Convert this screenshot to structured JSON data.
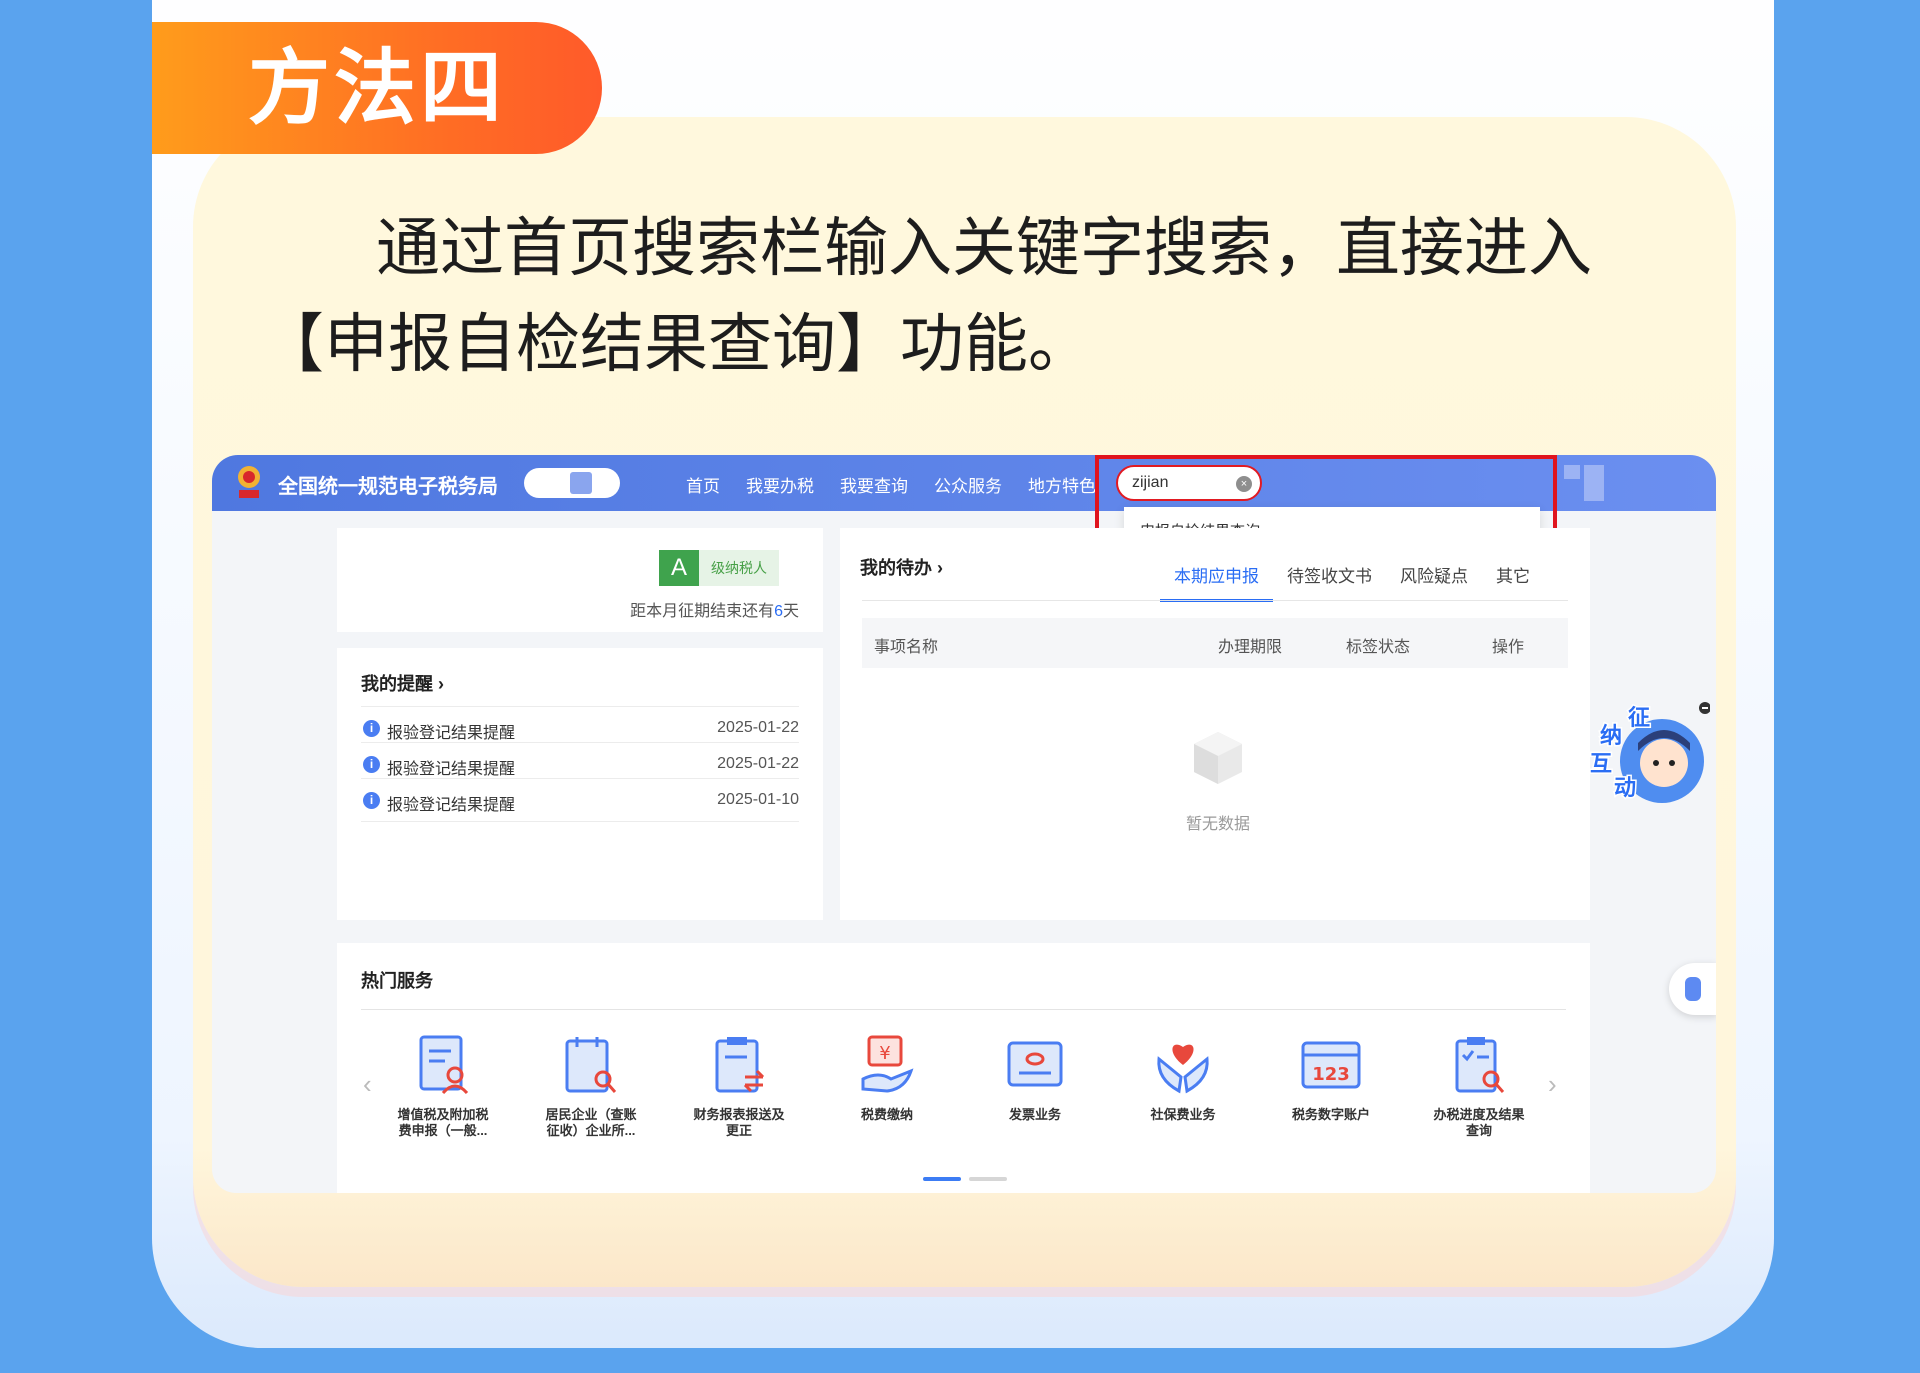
{
  "heading": "方法四",
  "intro": {
    "line1": "通过首页搜索栏输入关键字搜索，直接进入",
    "line2": "【申报自检结果查询】功能。"
  },
  "app": {
    "title": "全国统一规范电子税务局",
    "nav": [
      "首页",
      "我要办税",
      "我要查询",
      "公众服务",
      "地方特色"
    ],
    "search": {
      "value": "zijian",
      "suggestion": "申报自检结果查询"
    },
    "taxpayer": {
      "grade": "A",
      "grade_label": "级纳税人",
      "deadline_prefix": "距本月征期结束还有",
      "deadline_days": "6",
      "deadline_suffix": "天"
    },
    "reminders": {
      "title": "我的提醒",
      "items": [
        {
          "text": "报验登记结果提醒",
          "date": "2025-01-22"
        },
        {
          "text": "报验登记结果提醒",
          "date": "2025-01-22"
        },
        {
          "text": "报验登记结果提醒",
          "date": "2025-01-10"
        }
      ]
    },
    "todo": {
      "title": "我的待办",
      "tabs": [
        "本期应申报",
        "待签收文书",
        "风险疑点",
        "其它"
      ],
      "columns": [
        "事项名称",
        "办理期限",
        "标签状态",
        "操作"
      ],
      "empty": "暂无数据"
    },
    "hot": {
      "title": "热门服务",
      "items": [
        {
          "line1": "增值税及附加税",
          "line2": "费申报（一般..."
        },
        {
          "line1": "居民企业（查账",
          "line2": "征收）企业所..."
        },
        {
          "line1": "财务报表报送及",
          "line2": "更正"
        },
        {
          "line1": "税费缴纳",
          "line2": ""
        },
        {
          "line1": "发票业务",
          "line2": ""
        },
        {
          "line1": "社保费业务",
          "line2": ""
        },
        {
          "line1": "税务数字账户",
          "line2": ""
        },
        {
          "line1": "办税进度及结果",
          "line2": "查询"
        }
      ]
    },
    "mascot": [
      "征",
      "纳",
      "互",
      "动"
    ]
  },
  "colors": {
    "accent": "#2a6df4",
    "highlight": "#e0141e",
    "badge": "#ff7a1f",
    "topbar": "#5b80e6"
  }
}
